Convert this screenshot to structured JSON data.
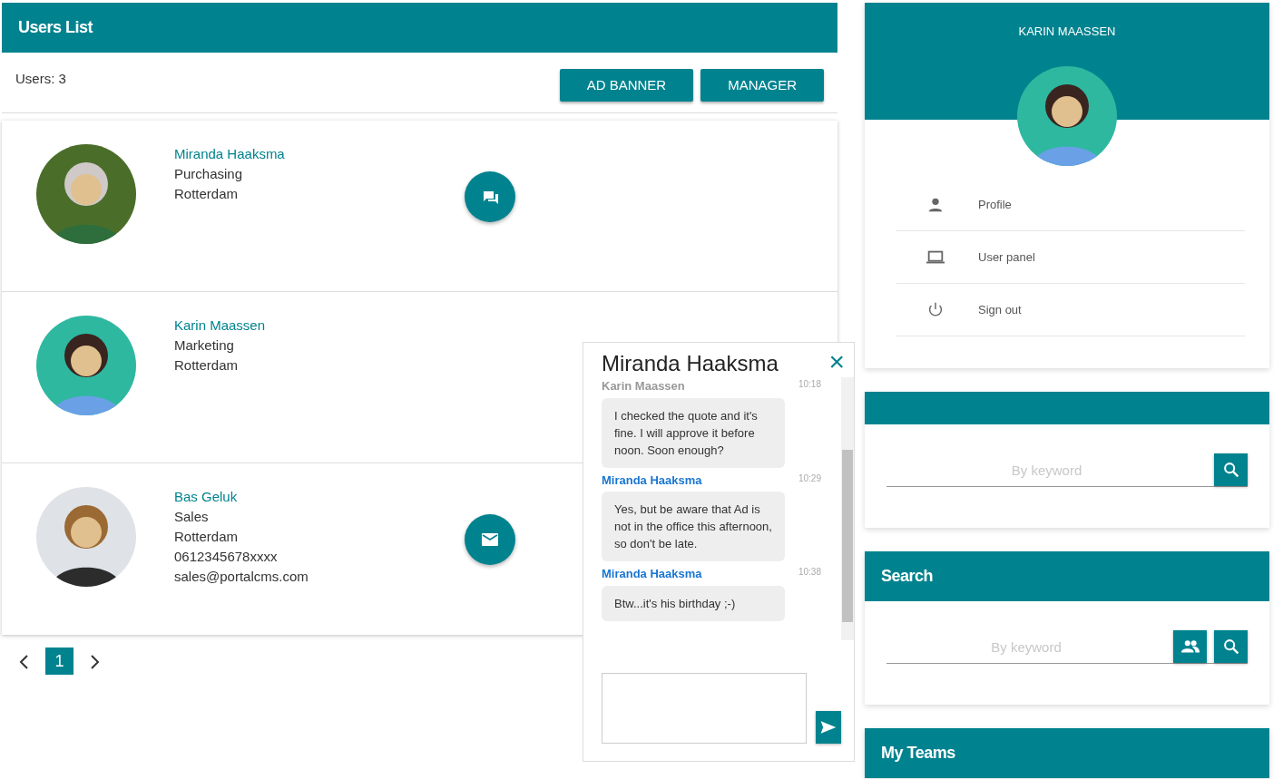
{
  "users_panel": {
    "title": "Users List",
    "count": "Users: 3",
    "buttons": [
      "AD BANNER",
      "MANAGER"
    ],
    "users": [
      {
        "name": "Miranda Haaksma",
        "details": [
          "Purchasing",
          "Rotterdam"
        ],
        "kind": "chat"
      },
      {
        "name": "Karin Maassen",
        "details": [
          "Marketing",
          "Rotterdam"
        ],
        "kind": "plain"
      },
      {
        "name": "Bas Geluk",
        "details": [
          "Sales",
          "Rotterdam",
          "0612345678xxxx",
          "sales@portalcms.com"
        ],
        "kind": "mail"
      }
    ],
    "pagination": {
      "pages": [
        {
          "label": "1",
          "selected": true
        }
      ]
    }
  },
  "chat": {
    "title": "Miranda Haaksma",
    "close": "×",
    "messages": [
      {
        "sender": "Karin Maassen",
        "time": "10:18",
        "text": "I checked the quote and it's fine. I will approve it before noon. Soon enough?",
        "kind": "incoming"
      },
      {
        "sender": "Miranda Haaksma",
        "time": "10:29",
        "text": "Yes, but be aware that Ad is not in the office this afternoon, so don't be late.",
        "kind": "outgoing"
      },
      {
        "sender": "Miranda Haaksma",
        "time": "10:38",
        "text": "Btw...it's his birthday ;-)",
        "kind": "outgoing"
      }
    ]
  },
  "profile": {
    "name": "KARIN MAASSEN",
    "menu": [
      {
        "label": "Profile",
        "kind": "person"
      },
      {
        "label": "User panel",
        "kind": "laptop"
      },
      {
        "label": "Sign out",
        "kind": "power"
      }
    ]
  },
  "search_cards": [
    {
      "placeholder": "By keyword",
      "buttons": [
        {
          "kind": "search"
        }
      ]
    },
    {
      "title": "Search",
      "placeholder": "By keyword",
      "buttons": [
        {
          "kind": "group"
        },
        {
          "kind": "search"
        }
      ]
    }
  ],
  "teams": {
    "title": "My Teams"
  }
}
